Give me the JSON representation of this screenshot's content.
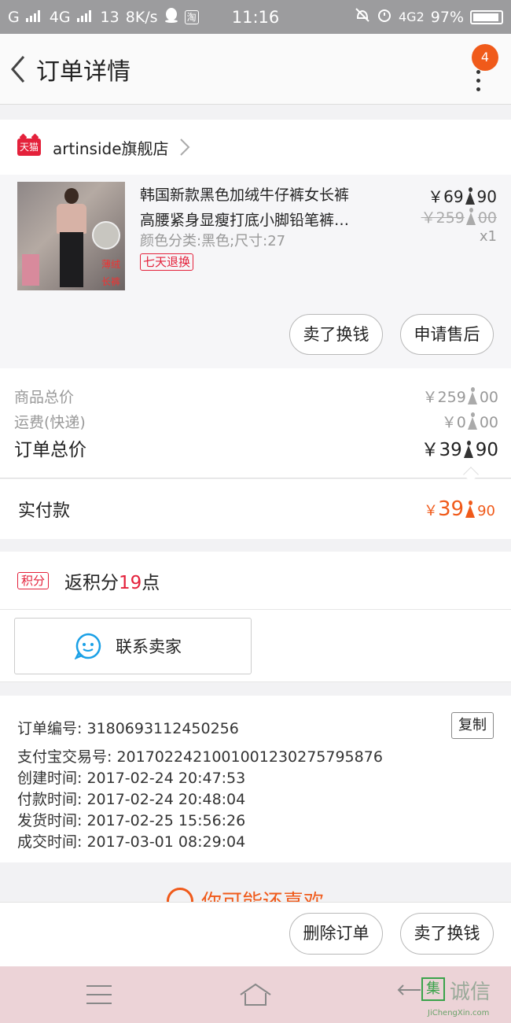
{
  "status_bar": {
    "left": "G",
    "network": "4G",
    "notif_count": "13",
    "speed": "8K/s",
    "taobao_badge": "淘",
    "time": "11:16",
    "net_right": "4G2",
    "battery": "97%"
  },
  "header": {
    "title": "订单详情",
    "more_badge": "4"
  },
  "shop": {
    "badge": "天猫",
    "name": "artinside旗舰店"
  },
  "product": {
    "title_line1": "韩国新款黑色加绒牛仔裤女长裤",
    "title_line2": "高腰紧身显瘦打底小脚铅笔裤…",
    "spec": "颜色分类:黑色;尺寸:27",
    "return_badge": "七天退换",
    "price_int": "￥69",
    "price_dec": "90",
    "orig_price_int": "￥259",
    "orig_price_dec": "00",
    "qty": "x1",
    "image_text_1": "薄绒",
    "image_text_2": "长裤",
    "btn_sell": "卖了换钱",
    "btn_aftersale": "申请售后"
  },
  "totals": {
    "goods_label": "商品总价",
    "goods_int": "￥259",
    "goods_dec": "00",
    "shipping_label": "运费(快递)",
    "shipping_int": "￥0",
    "shipping_dec": "00",
    "order_label": "订单总价",
    "order_int": "￥39",
    "order_dec": "90"
  },
  "paid": {
    "label": "实付款",
    "currency": "￥",
    "amount_int": "39",
    "amount_dec": "90"
  },
  "points": {
    "badge": "积分",
    "text_prefix": "返积分",
    "value": "19",
    "text_suffix": "点"
  },
  "contact": {
    "label": "联系卖家"
  },
  "order_info": {
    "order_no": "订单编号: 3180693112450256",
    "copy_label": "复制",
    "alipay_no": "支付宝交易号: 2017022421001001230275795876",
    "created": "创建时间: 2017-02-24  20:47:53",
    "paid_at": "付款时间: 2017-02-24  20:48:04",
    "shipped": "发货时间: 2017-02-25  15:56:26",
    "completed": "成交时间: 2017-03-01  08:29:04"
  },
  "recommend": {
    "title": "你可能还喜欢"
  },
  "bottom_bar": {
    "delete": "删除订单",
    "sell": "卖了换钱"
  },
  "watermark": {
    "box": "集",
    "name": "诚信",
    "url": "JiChengXin.com"
  },
  "colors": {
    "accent_orange": "#f05a1a",
    "tmall_red": "#e4213b",
    "status_bar": "#9c9c9e",
    "sys_nav": "#ecd3d7"
  },
  "icons": [
    "back-arrow-icon",
    "more-dots-icon",
    "tmall-icon",
    "chevron-right-icon",
    "wangwang-icon",
    "heart-icon",
    "menu-icon",
    "home-icon",
    "back-nav-icon"
  ]
}
